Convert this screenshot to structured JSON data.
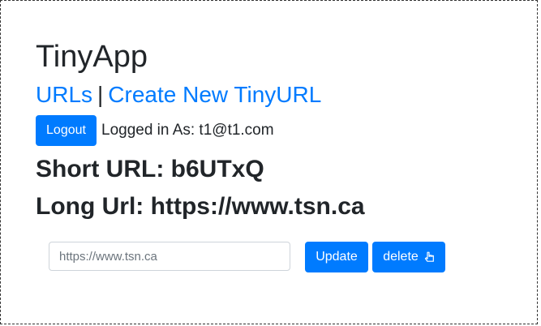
{
  "app": {
    "title": "TinyApp"
  },
  "nav": {
    "urls_label": "URLs",
    "separator": "|",
    "create_label": "Create New TinyURL"
  },
  "session": {
    "logout_label": "Logout",
    "logged_in_text": "Logged in As: t1@t1.com"
  },
  "url": {
    "short_label": "Short URL:",
    "short_value": "b6UTxQ",
    "long_label": "Long Url:",
    "long_value": "https://www.tsn.ca"
  },
  "form": {
    "input_placeholder": "https://www.tsn.ca",
    "update_label": "Update",
    "delete_label": "delete",
    "delete_icon": "hand-pointing-up-icon"
  },
  "colors": {
    "primary": "#007bff",
    "text": "#212529"
  }
}
